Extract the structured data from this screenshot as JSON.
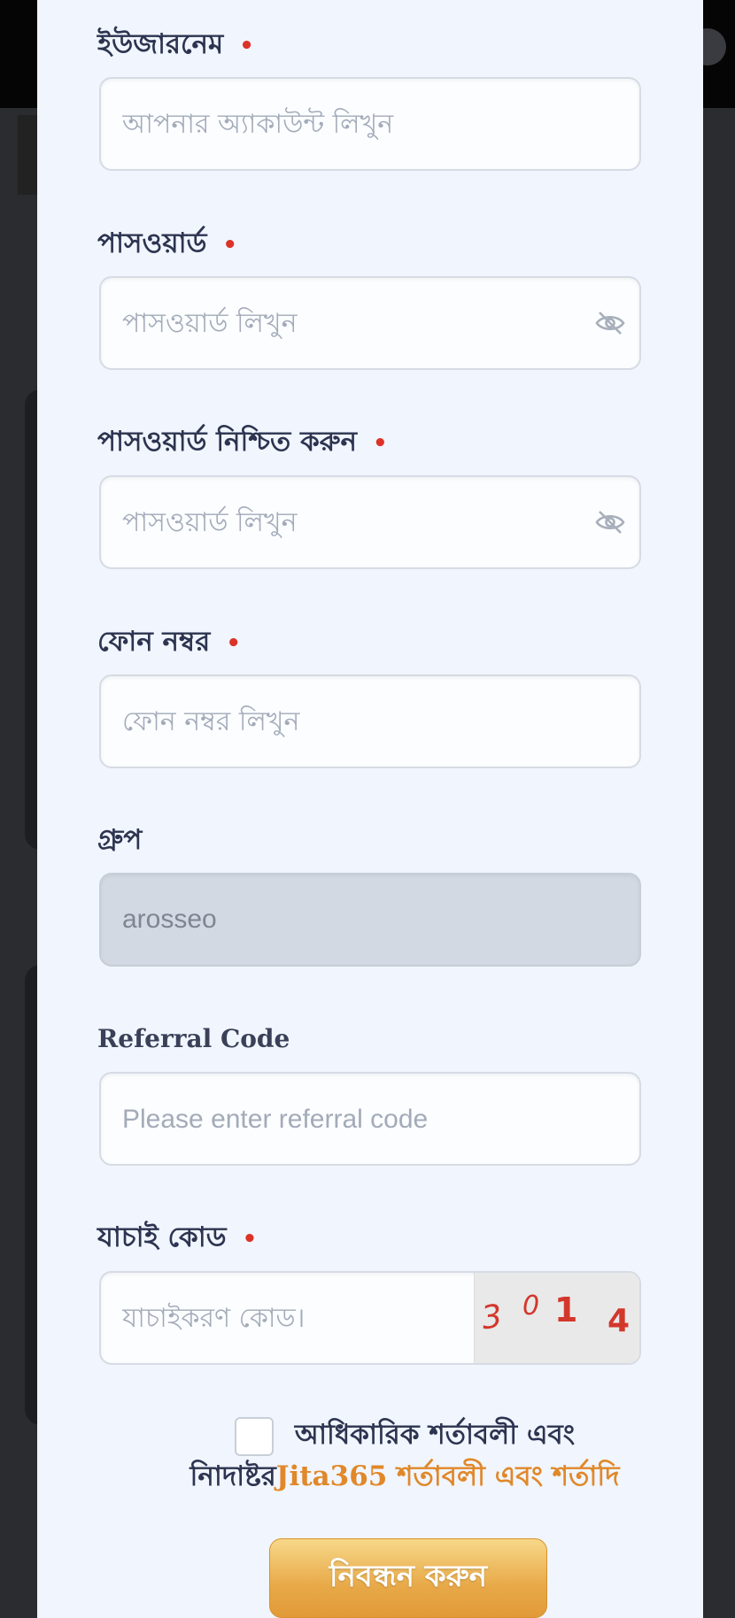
{
  "form": {
    "username": {
      "label": "ইউজারনেম",
      "required_mark": "•",
      "placeholder": "আপনার অ্যাকাউন্ট লিখুন"
    },
    "password": {
      "label": "পাসওয়ার্ড",
      "required_mark": "•",
      "placeholder": "পাসওয়ার্ড লিখুন",
      "toggle_icon": "eye-slash-icon"
    },
    "confirm_password": {
      "label": "পাসওয়ার্ড নিশ্চিত করুন",
      "required_mark": "•",
      "placeholder": "পাসওয়ার্ড লিখুন",
      "toggle_icon": "eye-slash-icon"
    },
    "phone": {
      "label": "ফোন নম্বর",
      "required_mark": "•",
      "placeholder": "ফোন নম্বর লিখুন"
    },
    "group": {
      "label": "গ্রুপ",
      "value": "arosseo"
    },
    "referral": {
      "label": "Referral Code",
      "placeholder": "Please enter referral code"
    },
    "verification": {
      "label": "যাচাই কোড",
      "required_mark": "•",
      "placeholder": "যাচাইকরণ কোড।",
      "captcha_chars": [
        "3",
        "0",
        "1",
        "4"
      ]
    }
  },
  "agreement": {
    "text_part1": "আধিকারিক শর্তাবলী এবং নিাদাষ্টর",
    "brand": "Jita365",
    "link_text": " শর্তাবলী এবং শর্তাদি"
  },
  "register_button": {
    "label": "নিবন্ধন করুন"
  },
  "colors": {
    "required": "#dc3228",
    "accent": "#e0882a",
    "label": "#2c3450",
    "panel": "#f1f5fd"
  }
}
